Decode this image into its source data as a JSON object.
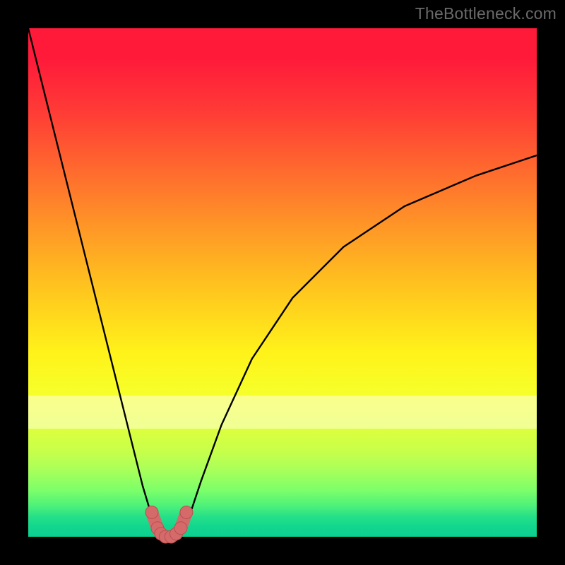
{
  "watermark": {
    "text": "TheBottleneck.com"
  },
  "chart_data": {
    "type": "line",
    "title": "",
    "xlabel": "",
    "ylabel": "",
    "xlim": [
      0,
      100
    ],
    "ylim": [
      0,
      100
    ],
    "grid": false,
    "series": [
      {
        "name": "curve",
        "x": [
          0,
          5,
          10,
          15,
          20,
          22.5,
          24,
          25.5,
          26.5,
          27.5,
          28.5,
          29.5,
          30.5,
          32,
          34,
          38,
          44,
          52,
          62,
          74,
          88,
          100
        ],
        "y": [
          100,
          80,
          60,
          40,
          20,
          10,
          5,
          1.5,
          0.4,
          0,
          0,
          0.4,
          1.5,
          5,
          11,
          22,
          35,
          47,
          57,
          65,
          71,
          75
        ]
      }
    ],
    "markers": {
      "name": "bottom-cluster",
      "color": "#d46a6a",
      "stroke": "#b85050",
      "radius_px": 9,
      "points": [
        {
          "x": 24.3,
          "y": 4.8
        },
        {
          "x": 25.4,
          "y": 1.7
        },
        {
          "x": 26.1,
          "y": 0.6
        },
        {
          "x": 27.0,
          "y": 0.0
        },
        {
          "x": 28.1,
          "y": 0.0
        },
        {
          "x": 29.1,
          "y": 0.6
        },
        {
          "x": 30.0,
          "y": 1.7
        },
        {
          "x": 31.1,
          "y": 4.8
        }
      ]
    },
    "background_gradient": {
      "top": "#ff1a3a",
      "mid": "#fff31a",
      "bottom": "#0cd090"
    }
  }
}
